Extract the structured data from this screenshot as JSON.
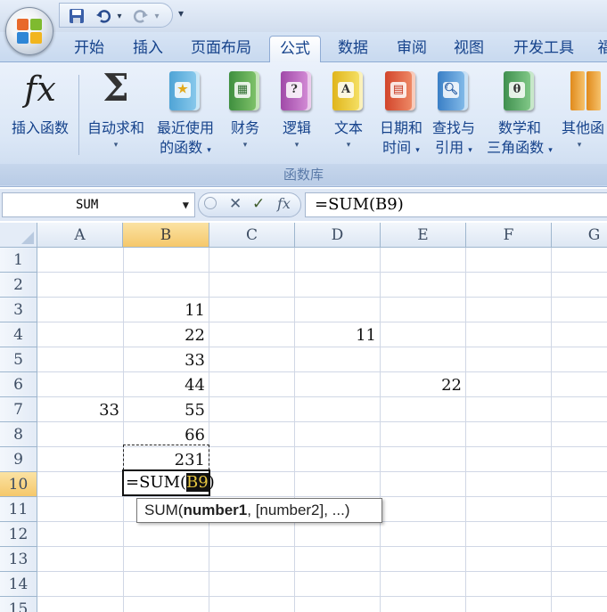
{
  "qat": {
    "save_icon": "save-icon",
    "undo_icon": "undo-icon",
    "redo_icon": "redo-icon",
    "customize": "▾"
  },
  "tabs": [
    {
      "label": "开始"
    },
    {
      "label": "插入"
    },
    {
      "label": "页面布局"
    },
    {
      "label": "公式",
      "active": true
    },
    {
      "label": "数据"
    },
    {
      "label": "审阅"
    },
    {
      "label": "视图"
    },
    {
      "label": "开发工具"
    },
    {
      "label": "福"
    }
  ],
  "ribbon": {
    "insert_function": {
      "icon_text": "fx",
      "line1": "插入函数"
    },
    "autosum": {
      "icon_text": "Σ",
      "line1": "自动求和"
    },
    "recent": {
      "line1": "最近使用",
      "line2": "的函数"
    },
    "financial": {
      "line1": "财务"
    },
    "logical": {
      "icon_text": "?",
      "line1": "逻辑"
    },
    "text": {
      "icon_text": "A",
      "line1": "文本"
    },
    "datetime": {
      "line1": "日期和",
      "line2": "时间"
    },
    "lookup": {
      "line1": "查找与",
      "line2": "引用"
    },
    "math": {
      "icon_text": "θ",
      "line1": "数学和",
      "line2": "三角函数"
    },
    "more": {
      "line1": "其他函"
    },
    "group_label": "函数库",
    "dropdown_arrow": "▾"
  },
  "formula_bar": {
    "name_box": "SUM",
    "cancel": "✕",
    "enter": "✓",
    "fx": "fx",
    "formula": "=SUM(B9)"
  },
  "grid": {
    "columns": [
      "A",
      "B",
      "C",
      "D",
      "E",
      "F",
      "G"
    ],
    "rows": [
      "1",
      "2",
      "3",
      "4",
      "5",
      "6",
      "7",
      "8",
      "9",
      "10",
      "11",
      "12",
      "13",
      "14",
      "15"
    ],
    "cells": {
      "B3": "11",
      "B4": "22",
      "B5": "33",
      "B6": "44",
      "B7": "55",
      "B8": "66",
      "B9": "231",
      "D4": "11",
      "E6": "22",
      "A7": "33"
    },
    "edit_prefix": "=SUM(",
    "edit_ref": "B9",
    "edit_suffix": ")",
    "tooltip_fn": "SUM(",
    "tooltip_arg1": "number1",
    "tooltip_rest": ", [number2], ...)"
  }
}
